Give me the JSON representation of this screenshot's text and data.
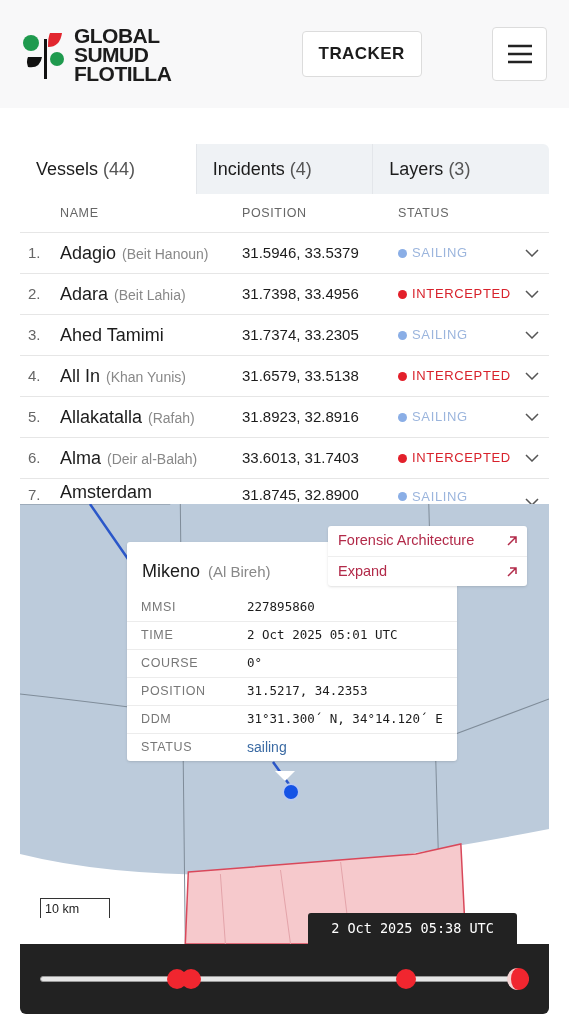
{
  "header": {
    "logo_lines": [
      "GLOBAL",
      "SUMUD",
      "FLOTILLA"
    ],
    "tracker_button": "TRACKER"
  },
  "tabs": [
    {
      "label": "Vessels",
      "count": "(44)",
      "selected": true
    },
    {
      "label": "Incidents",
      "count": "(4)",
      "selected": false
    },
    {
      "label": "Layers",
      "count": "(3)",
      "selected": false
    }
  ],
  "table": {
    "columns": [
      "NAME",
      "POSITION",
      "STATUS"
    ],
    "rows": [
      {
        "index": "1.",
        "name": "Adagio",
        "alias": "(Beit Hanoun)",
        "position": "31.5946, 33.5379",
        "status": "SAILING",
        "kind": "sailing"
      },
      {
        "index": "2.",
        "name": "Adara",
        "alias": "(Beit Lahia)",
        "position": "31.7398, 33.4956",
        "status": "INTERCEPTED",
        "kind": "intercepted"
      },
      {
        "index": "3.",
        "name": "Ahed Tamimi",
        "position": "31.7374, 33.2305",
        "status": "SAILING",
        "kind": "sailing"
      },
      {
        "index": "4.",
        "name": "All In",
        "alias": "(Khan Yunis)",
        "position": "31.6579, 33.5138",
        "status": "INTERCEPTED",
        "kind": "intercepted"
      },
      {
        "index": "5.",
        "name": "Allakatalla",
        "alias": "(Rafah)",
        "position": "31.8923, 32.8916",
        "status": "SAILING",
        "kind": "sailing"
      },
      {
        "index": "6.",
        "name": "Alma",
        "alias": "(Deir al-Balah)",
        "position": "33.6013, 31.7403",
        "status": "INTERCEPTED",
        "kind": "intercepted"
      },
      {
        "index": "7.",
        "name": "Amsterdam",
        "position": "31.8745, 32.8900",
        "status": "SAILING",
        "kind": "sailing"
      }
    ]
  },
  "map": {
    "popup": {
      "name": "Mikeno",
      "alias": "(Al Bireh)",
      "fields": [
        {
          "label": "MMSI",
          "value": "227895860"
        },
        {
          "label": "TIME",
          "value": "2 Oct 2025 05:01 UTC"
        },
        {
          "label": "COURSE",
          "value": "0°"
        },
        {
          "label": "POSITION",
          "value": "31.5217, 34.2353"
        },
        {
          "label": "DDM",
          "value": "31°31.300´ N, 34°14.120´ E"
        },
        {
          "label": "STATUS",
          "value": "sailing",
          "kind": "status"
        }
      ]
    },
    "links": [
      "Forensic Architecture",
      "Expand"
    ],
    "scale": "10 km"
  },
  "timeline": {
    "time": "2 Oct 2025 05:38 UTC",
    "level": 1.0,
    "markers": [
      {
        "level": 0.27
      },
      {
        "level": 0.3
      },
      {
        "level": 0.76
      }
    ]
  }
}
